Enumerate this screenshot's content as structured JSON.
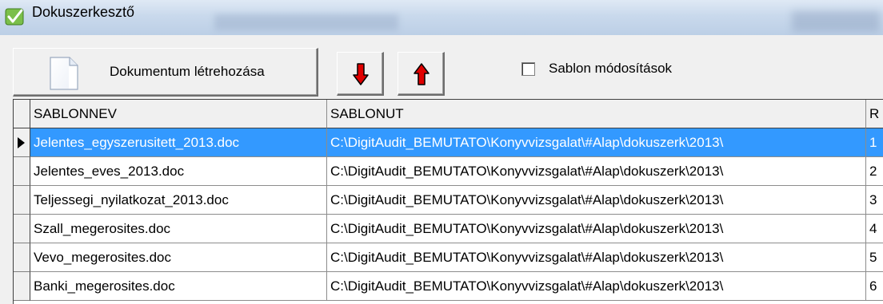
{
  "window": {
    "title": "Dokuszerkesztő"
  },
  "toolbar": {
    "create_label": "Dokumentum létrehozása",
    "down_icon": "red-down-arrow-icon",
    "up_icon": "red-up-arrow-icon",
    "checkbox_label": "Sablon módosítások",
    "checkbox_checked": false
  },
  "colors": {
    "selection": "#3399ff",
    "arrow": "#e00000"
  },
  "grid": {
    "headers": [
      "SABLONNEV",
      "SABLONUT",
      "R"
    ],
    "selected_row": 0,
    "rows": [
      {
        "name": "Jelentes_egyszerusitett_2013.doc",
        "path": "C:\\DigitAudit_BEMUTATO\\Konyvvizsgalat\\#Alap\\dokuszerk\\2013\\",
        "r": "1"
      },
      {
        "name": "Jelentes_eves_2013.doc",
        "path": "C:\\DigitAudit_BEMUTATO\\Konyvvizsgalat\\#Alap\\dokuszerk\\2013\\",
        "r": "2"
      },
      {
        "name": "Teljessegi_nyilatkozat_2013.doc",
        "path": "C:\\DigitAudit_BEMUTATO\\Konyvvizsgalat\\#Alap\\dokuszerk\\2013\\",
        "r": "3"
      },
      {
        "name": "Szall_megerosites.doc",
        "path": "C:\\DigitAudit_BEMUTATO\\Konyvvizsgalat\\#Alap\\dokuszerk\\2013\\",
        "r": "4"
      },
      {
        "name": "Vevo_megerosites.doc",
        "path": "C:\\DigitAudit_BEMUTATO\\Konyvvizsgalat\\#Alap\\dokuszerk\\2013\\",
        "r": "5"
      },
      {
        "name": "Banki_megerosites.doc",
        "path": "C:\\DigitAudit_BEMUTATO\\Konyvvizsgalat\\#Alap\\dokuszerk\\2013\\",
        "r": "6"
      }
    ]
  }
}
